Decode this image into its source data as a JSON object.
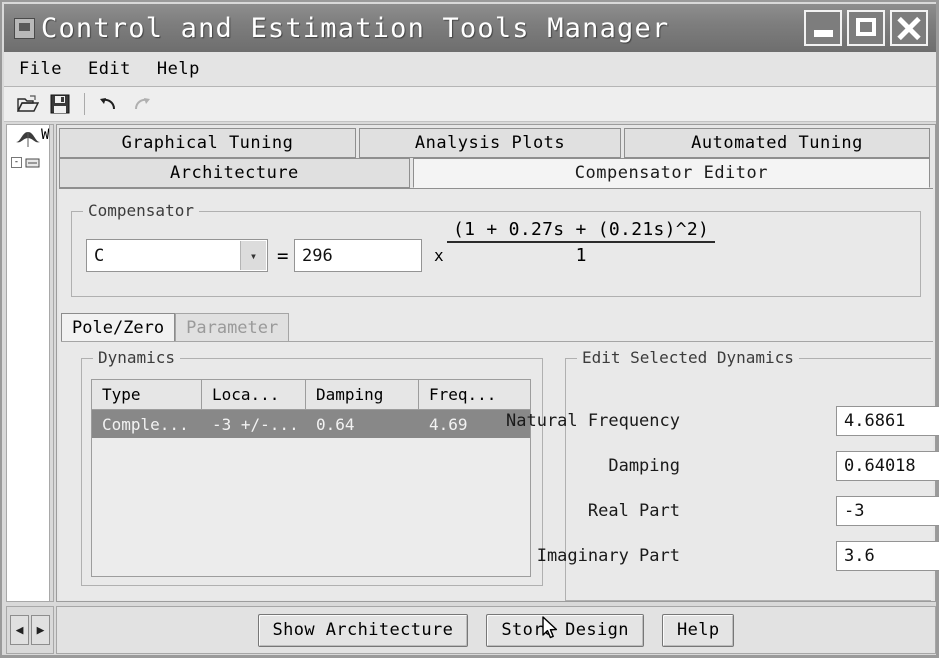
{
  "window": {
    "title": "Control and Estimation Tools Manager",
    "app_icon": "matlab-window-icon",
    "controls": {
      "minimize": "minimize-button",
      "maximize": "maximize-button",
      "close": "close-button"
    }
  },
  "menubar": {
    "items": [
      {
        "label": "File"
      },
      {
        "label": "Edit"
      },
      {
        "label": "Help"
      }
    ]
  },
  "toolbar": {
    "buttons": [
      {
        "icon": "open-folder-icon",
        "enabled": true
      },
      {
        "icon": "save-floppy-icon",
        "enabled": true
      },
      {
        "icon": "undo-arrow-icon",
        "enabled": true
      },
      {
        "icon": "redo-arrow-icon",
        "enabled": false
      }
    ]
  },
  "tree": {
    "root_label": "W",
    "child_label": "",
    "expander": "-",
    "root_icon": "matlab-membrane-icon",
    "node_icon": "design-node-icon"
  },
  "hscroll": {
    "left_arrow": "◀",
    "right_arrow": "▶"
  },
  "tabs": {
    "row1": [
      {
        "label": "Graphical Tuning",
        "selected": false
      },
      {
        "label": "Analysis Plots",
        "selected": false
      },
      {
        "label": "Automated Tuning",
        "selected": false
      }
    ],
    "row2": [
      {
        "label": "Architecture",
        "selected": false
      },
      {
        "label": "Compensator Editor",
        "selected": true
      }
    ]
  },
  "compensator": {
    "group_title": "Compensator",
    "selector_value": "C",
    "selector_arrow": "▾",
    "equals": "=",
    "gain_value": "296",
    "multiply": "x",
    "numerator": "(1 + 0.27s +  (0.21s)^2)",
    "denominator": "1"
  },
  "inner_tabs": [
    {
      "label": "Pole/Zero",
      "selected": true,
      "enabled": true
    },
    {
      "label": "Parameter",
      "selected": false,
      "enabled": false
    }
  ],
  "dynamics": {
    "group_title": "Dynamics",
    "columns": [
      "Type",
      "Loca...",
      "Damping",
      "Freq..."
    ],
    "rows": [
      {
        "type": "Comple...",
        "location": "-3 +/-...",
        "damping": "0.64",
        "frequency": "4.69",
        "selected": true
      }
    ]
  },
  "edit_selected": {
    "group_title": "Edit Selected Dynamics",
    "fields": [
      {
        "label": "Natural Frequency",
        "value": "4.6861"
      },
      {
        "label": "Damping",
        "value": "0.64018"
      },
      {
        "label": "Real Part",
        "value": "-3"
      },
      {
        "label": "Imaginary Part",
        "value": "3.6"
      }
    ]
  },
  "footer": {
    "buttons": [
      {
        "label": "Show Architecture"
      },
      {
        "label": "Store Design"
      },
      {
        "label": "Help"
      }
    ]
  },
  "colors": {
    "titlebar": "#7e7e7e",
    "panel": "#e9e9e9",
    "selected_row": "#888888",
    "field_bg": "#ffffff"
  }
}
